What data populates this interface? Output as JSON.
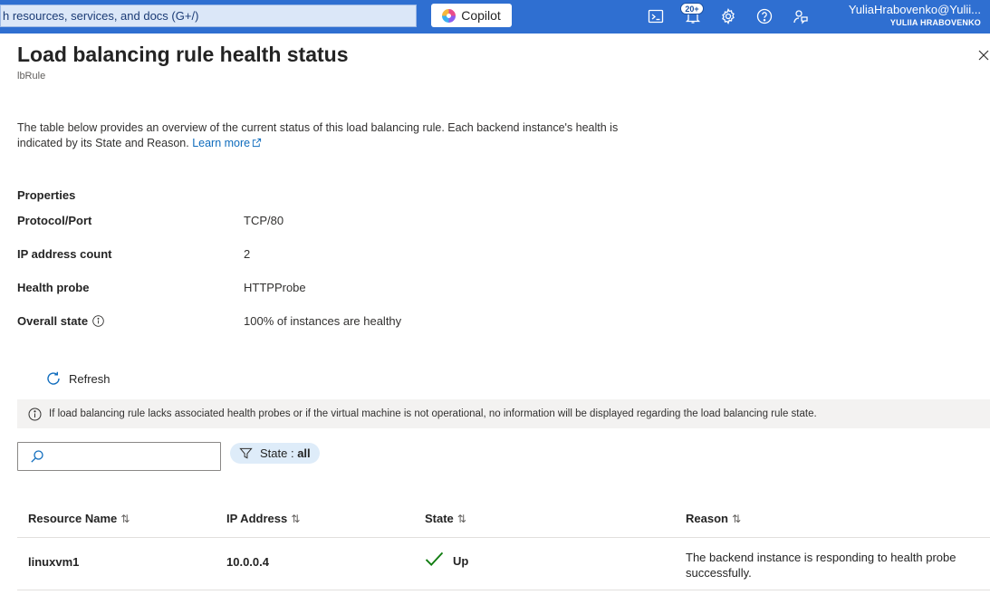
{
  "topbar": {
    "search_placeholder": "h resources, services, and docs (G+/)",
    "copilot_label": "Copilot",
    "notification_badge": "20+",
    "user_email": "YuliaHrabovenko@Yulii...",
    "user_tenant": "YULIIA HRABOVENKO",
    "icons": [
      "cloud-shell-icon",
      "notifications-icon",
      "settings-icon",
      "help-icon",
      "feedback-icon"
    ]
  },
  "panel": {
    "title": "Load balancing rule health status",
    "subtitle": "lbRule",
    "description": "The table below provides an overview of the current status of this load balancing rule. Each backend instance's health is indicated by its State and Reason.",
    "learn_more": "Learn more"
  },
  "properties": {
    "heading": "Properties",
    "rows": [
      {
        "label": "Protocol/Port",
        "value": "TCP/80"
      },
      {
        "label": "IP address count",
        "value": "2"
      },
      {
        "label": "Health probe",
        "value": "HTTPProbe"
      },
      {
        "label": "Overall state",
        "value": "100% of instances are healthy"
      }
    ]
  },
  "toolbar": {
    "refresh_label": "Refresh"
  },
  "info_bar": {
    "text": "If load balancing rule lacks associated health probes or if the virtual machine is not operational, no information will be displayed regarding the load balancing rule state."
  },
  "filter": {
    "search_value": "",
    "state_label": "State : ",
    "state_value": "all"
  },
  "table": {
    "columns": [
      "Resource Name",
      "IP Address",
      "State",
      "Reason"
    ],
    "rows": [
      {
        "resource_name": "linuxvm1",
        "ip_address": "10.0.0.4",
        "state": "Up",
        "reason": "The backend instance is responding to health probe successfully."
      }
    ]
  },
  "colors": {
    "topbar": "#2f6fd1",
    "link": "#0f6cbd",
    "healthy_check": "#107c10",
    "state_pill": "#deecf9"
  }
}
